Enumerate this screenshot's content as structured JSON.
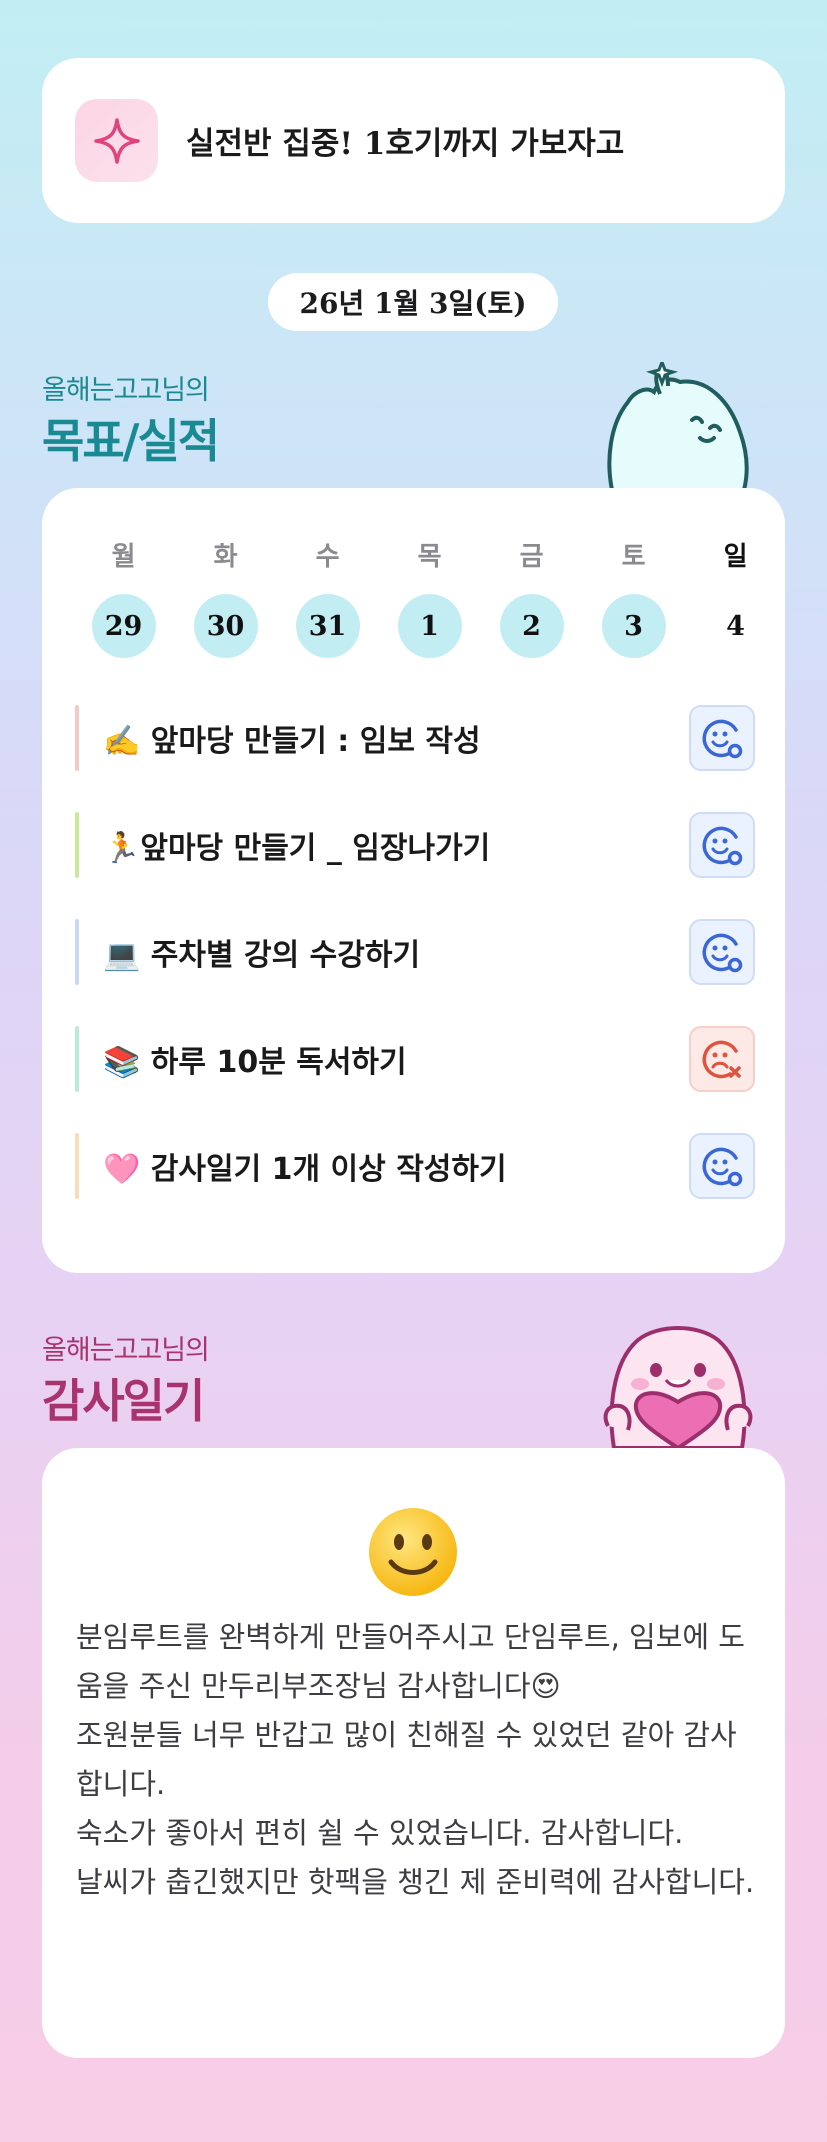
{
  "motto": {
    "text": "실전반 집중! 1호기까지 가보자고",
    "icon": "sparkle-icon"
  },
  "date": {
    "label": "26년 1월 3일(토)"
  },
  "goals_section": {
    "subtitle": "올해는고고님의",
    "title": "목표/실적"
  },
  "week": {
    "days": [
      {
        "name": "월",
        "num": "29",
        "highlighted": true
      },
      {
        "name": "화",
        "num": "30",
        "highlighted": true
      },
      {
        "name": "수",
        "num": "31",
        "highlighted": true
      },
      {
        "name": "목",
        "num": "1",
        "highlighted": true
      },
      {
        "name": "금",
        "num": "2",
        "highlighted": true
      },
      {
        "name": "토",
        "num": "3",
        "highlighted": true
      },
      {
        "name": "일",
        "num": "4",
        "highlighted": false
      }
    ]
  },
  "goals": [
    {
      "text": "✍️ 앞마당 만들기 : 임보 작성",
      "bar_color": "#f8c9c3",
      "status": "done"
    },
    {
      "text": "🏃앞마당 만들기 _ 임장나가기",
      "bar_color": "#c9ea9c",
      "status": "done"
    },
    {
      "text": "💻 주차별 강의 수강하기",
      "bar_color": "#c8d9f3",
      "status": "done"
    },
    {
      "text": "📚 하루 10분 독서하기",
      "bar_color": "#b8ecd9",
      "status": "missed"
    },
    {
      "text": "🩷 감사일기 1개 이상 작성하기",
      "bar_color": "#fbdcb8",
      "status": "done"
    }
  ],
  "gratitude_section": {
    "subtitle": "올해는고고님의",
    "title": "감사일기"
  },
  "gratitude": {
    "emoji": "smile-emoji-icon",
    "paragraphs": [
      "분임루트를 완벽하게 만들어주시고 단임루트, 임보에 도움을 주신 만두리부조장님 감사합니다😍",
      "조원분들 너무 반갑고 많이 친해질 수 있었던 같아 감사합니다.",
      "숙소가 좋아서 편히 쉴 수 있었습니다. 감사합니다.",
      "날씨가 춥긴했지만 핫팩을 챙긴 제 준비력에 감사합니다."
    ]
  },
  "colors": {
    "done": "#3b67d6",
    "missed": "#e0533f",
    "accent_teal": "#1a8a92",
    "accent_pink": "#a8336f",
    "day_circle": "#c2eef3"
  }
}
